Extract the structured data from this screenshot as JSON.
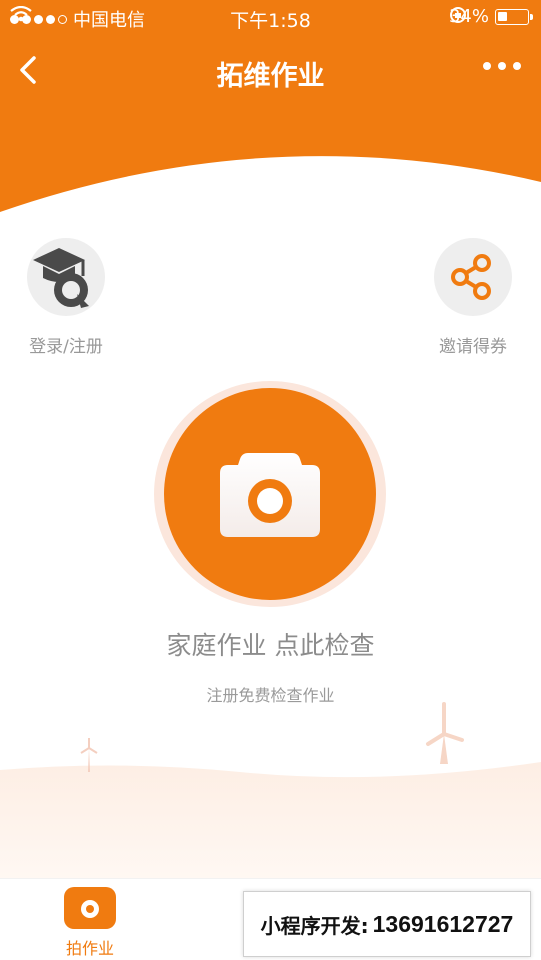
{
  "status_bar": {
    "carrier": "中国电信",
    "time": "下午1:58",
    "battery": "34%",
    "battery_level": 0.34
  },
  "nav": {
    "title": "拓维作业",
    "back_icon": "chevron-left-icon",
    "more_icon": "more-dots-icon"
  },
  "actions": {
    "login_label": "登录/注册",
    "invite_label": "邀请得券"
  },
  "main": {
    "title": "家庭作业 点此检查",
    "subtitle": "注册免费检查作业"
  },
  "tabbar": {
    "tab_label": "拍作业"
  },
  "promo": {
    "label": "小程序开发:",
    "phone": "13691612727"
  },
  "colors": {
    "accent": "#f07b10",
    "header": "#f07b10",
    "light_circle": "#eeeeee"
  }
}
